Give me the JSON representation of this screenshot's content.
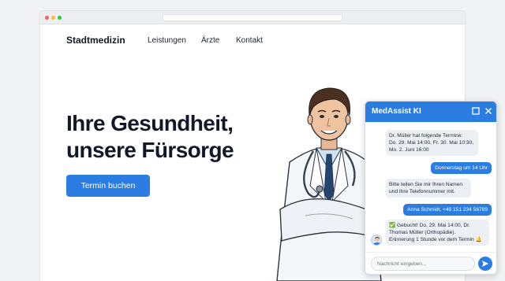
{
  "browser": {
    "dots": [
      {
        "name": "close",
        "color": "#ff5f57"
      },
      {
        "name": "minimize",
        "color": "#febc2e"
      },
      {
        "name": "maximize",
        "color": "#28c840"
      }
    ]
  },
  "nav": {
    "logo": "Stadtmedizin",
    "links": [
      "Leistungen",
      "Ärzte",
      "Kontakt"
    ]
  },
  "hero": {
    "title_line1": "Ihre Gesundheit,",
    "title_line2": "unsere Fürsorge",
    "cta": "Termin buchen"
  },
  "chat": {
    "title": "MedAssist KI",
    "maximize_icon": "square-icon",
    "close_icon": "close-icon",
    "messages": [
      {
        "from": "bot",
        "lines": [
          "Dr. Müller hat folgende Termine:",
          "Do. 29. Mai 14:00, Fr. 30. Mai 10:30,",
          "Mo. 2. Juni 16:00"
        ]
      },
      {
        "from": "user",
        "lines": [
          "Donnerstag um 14 Uhr"
        ]
      },
      {
        "from": "bot",
        "lines": [
          "Bitte teilen Sie mir Ihren Namen",
          "und Ihre Telefonnummer mit."
        ]
      },
      {
        "from": "user",
        "lines": [
          "Anna Schmidt, +49 151 234 56789"
        ]
      },
      {
        "from": "bot",
        "lines": [
          "✅ Gebucht! Do. 29. Mai 14:00, Dr.",
          "Thomas Müller (Orthopädie).",
          "Erinnerung 1 Stunde vor dem Termin 🔔"
        ]
      }
    ],
    "input_placeholder": "Nachricht eingeben...",
    "accent": "#2b7de1"
  }
}
